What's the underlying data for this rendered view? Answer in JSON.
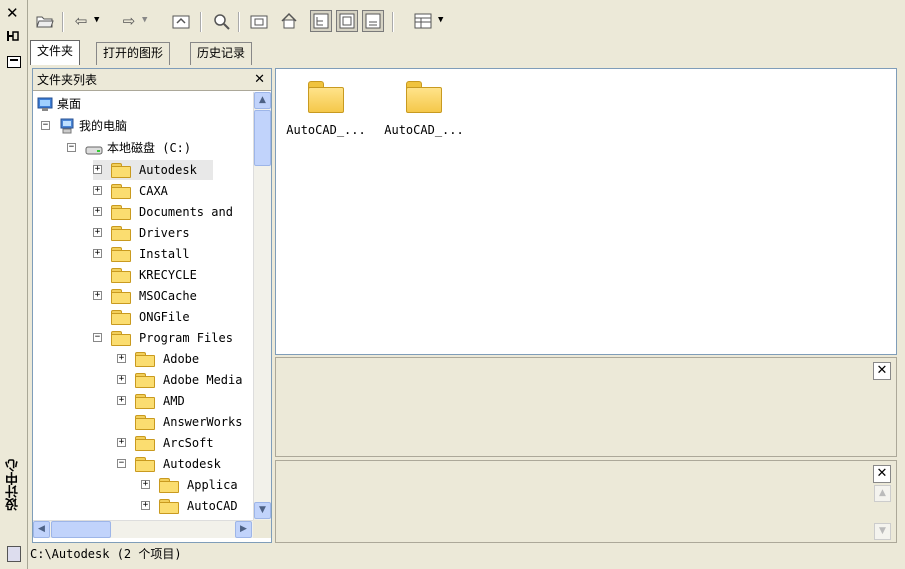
{
  "palette": {
    "title": "设计中心"
  },
  "toolbar": {
    "buttons": [
      "load-icon",
      "back-icon",
      "forward-icon",
      "up-icon",
      "search-icon",
      "favorites-icon",
      "home-icon",
      "tree-toggle-icon",
      "preview-icon",
      "description-icon",
      "views-icon"
    ]
  },
  "tabs": [
    "文件夹",
    "打开的图形",
    "历史记录"
  ],
  "tree": {
    "title": "文件夹列表",
    "nodes": [
      {
        "label": "桌面"
      },
      {
        "label": "我的电脑"
      },
      {
        "label": "本地磁盘 (C:)"
      },
      {
        "label": "Autodesk"
      },
      {
        "label": "CAXA"
      },
      {
        "label": "Documents and"
      },
      {
        "label": "Drivers"
      },
      {
        "label": "Install"
      },
      {
        "label": "KRECYCLE"
      },
      {
        "label": "MSOCache"
      },
      {
        "label": "ONGFile"
      },
      {
        "label": "Program Files"
      },
      {
        "label": "Adobe"
      },
      {
        "label": "Adobe Media"
      },
      {
        "label": "AMD"
      },
      {
        "label": "AnswerWorks"
      },
      {
        "label": "ArcSoft"
      },
      {
        "label": "Autodesk"
      },
      {
        "label": "Applica"
      },
      {
        "label": "AutoCAD"
      }
    ]
  },
  "content": {
    "items": [
      {
        "label": "AutoCAD_..."
      },
      {
        "label": "AutoCAD_..."
      }
    ]
  },
  "status": {
    "text": "C:\\Autodesk (2 个项目)"
  }
}
